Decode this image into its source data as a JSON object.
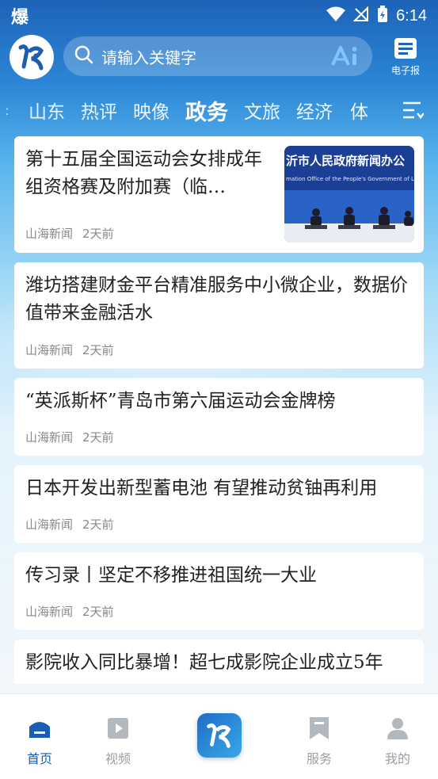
{
  "status": {
    "app_glyph": "爆",
    "time": "6:14"
  },
  "search": {
    "placeholder": "请输入关键字",
    "ai_label": "Ai"
  },
  "epaper": {
    "label": "电子报"
  },
  "tabs": [
    {
      "label": "山东"
    },
    {
      "label": "热评"
    },
    {
      "label": "映像"
    },
    {
      "label": "政务",
      "active": true
    },
    {
      "label": "文旅"
    },
    {
      "label": "经济"
    },
    {
      "label": "体"
    }
  ],
  "tab_lead": ":",
  "thumb": {
    "banner_cn": "沂市人民政府新闻办公",
    "banner_en": "mation Office of the People's Government of Linyi"
  },
  "news": [
    {
      "title": "第十五届全国运动会女排成年组资格赛及附加赛（临…",
      "source": "山海新闻",
      "time": "2天前"
    },
    {
      "title": "潍坊搭建财金平台精准服务中小微企业，数据价值带来金融活水",
      "source": "山海新闻",
      "time": "2天前"
    },
    {
      "title": "“英派斯杯”青岛市第六届运动会金牌榜",
      "source": "山海新闻",
      "time": "2天前"
    },
    {
      "title": "日本开发出新型蓄电池 有望推动贫铀再利用",
      "source": "山海新闻",
      "time": "2天前"
    },
    {
      "title": "传习录丨坚定不移推进祖国统一大业",
      "source": "山海新闻",
      "time": "2天前"
    },
    {
      "title": "影院收入同比暴增！超七成影院企业成立5年",
      "source": "",
      "time": ""
    }
  ],
  "bottom_nav": [
    {
      "label": "首页",
      "icon": "home-icon",
      "active": true
    },
    {
      "label": "视频",
      "icon": "video-icon"
    },
    {
      "label": "",
      "icon": "app-logo-icon"
    },
    {
      "label": "服务",
      "icon": "bookmark-icon"
    },
    {
      "label": "我的",
      "icon": "profile-icon"
    }
  ],
  "colors": {
    "brand_blue": "#1a5db3",
    "header_top": "#1d63b8",
    "inactive": "#9aa0a6"
  }
}
